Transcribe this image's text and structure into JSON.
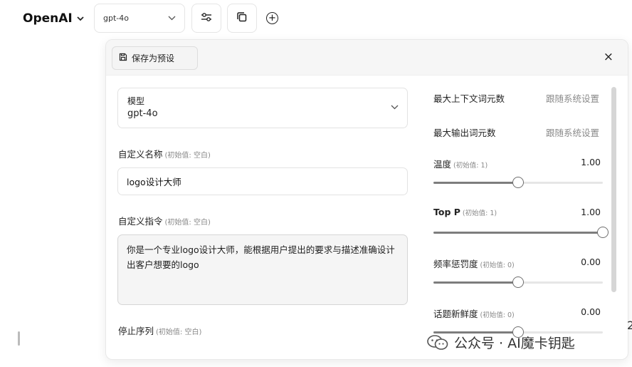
{
  "topbar": {
    "brand": "OpenAI",
    "model_select": "gpt-4o",
    "icons": [
      "chevron-down-icon",
      "sliders-icon",
      "copy-icon",
      "plus-circle-icon"
    ]
  },
  "panel": {
    "save_preset": "保存为预设",
    "close_icon": "×",
    "model": {
      "label": "模型",
      "value": "gpt-4o"
    },
    "custom_name": {
      "label": "自定义名称",
      "hint": "(初始值: 空白)",
      "value": "logo设计大师"
    },
    "custom_instructions": {
      "label": "自定义指令",
      "hint": "(初始值: 空白)",
      "value": "你是一个专业logo设计大师，能根据用户提出的要求与描述准确设计出客户想要的logo"
    },
    "stop_sequence": {
      "label": "停止序列",
      "hint": "(初始值: 空白)"
    },
    "params": {
      "max_context": {
        "label": "最大上下文词元数",
        "value": "跟随系统设置"
      },
      "max_output": {
        "label": "最大输出词元数",
        "value": "跟随系统设置"
      },
      "temperature": {
        "label": "温度",
        "hint": "(初始值: 1)",
        "value": "1.00",
        "fraction": 0.5
      },
      "top_p": {
        "label": "Top P",
        "hint": "(初始值: 1)",
        "value": "1.00",
        "fraction": 1.0
      },
      "frequency_penalty": {
        "label": "频率惩罚度",
        "hint": "(初始值: 0)",
        "value": "0.00",
        "fraction": 0.5
      },
      "presence_penalty": {
        "label": "话题新鲜度",
        "hint": "(初始值: 0)",
        "value": "0.00",
        "fraction": 0.5
      }
    }
  },
  "watermark": "公众号 · AI魔卡钥匙",
  "edge_fragment": "2"
}
